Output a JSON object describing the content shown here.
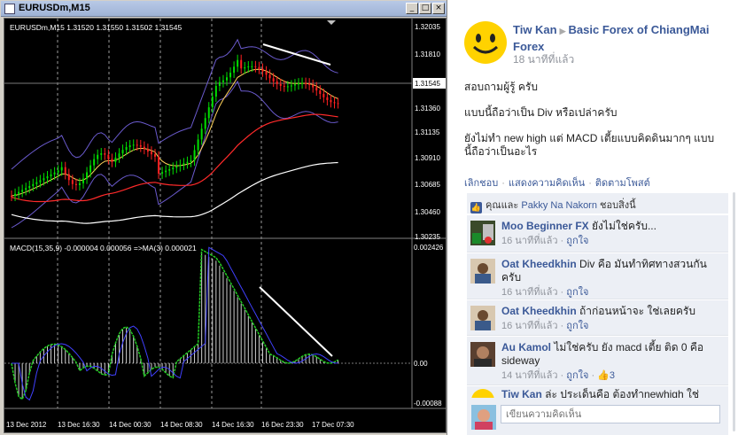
{
  "mt4": {
    "window_title": "EURUSDm,M15",
    "win_buttons": [
      "_",
      "□",
      "×"
    ],
    "info_line": "EURUSDm,M15  1.31520 1.31550 1.31502 1.31545",
    "price_ticks": [
      "1.32035",
      "1.31810",
      "1.31360",
      "1.31135",
      "1.30910",
      "1.30685",
      "1.30460",
      "1.30235"
    ],
    "current_price": "1.31545",
    "macd_label": "MACD(15,35,9) -0.000004 0.000056  =>MA(3) 0.000021",
    "macd_ticks": [
      "0.002426",
      "0.00",
      "-0.00088"
    ],
    "time_ticks": [
      "13 Dec 2012",
      "13 Dec 16:30",
      "14 Dec 00:30",
      "14 Dec 08:30",
      "14 Dec 16:30",
      "16 Dec 23:30",
      "17 Dec 07:30"
    ],
    "colors": {
      "bull": "#00e000",
      "bear": "#ff2020",
      "band": "#6a5acd",
      "ema_slow": "#ffffff",
      "ema_mid": "#ff2a2a",
      "ema_fast": "#ffd35a",
      "divergence_line": "#ffffff"
    }
  },
  "post": {
    "author": "Tiw Kan",
    "group": "Basic Forex of ChiangMai Forex",
    "time": "18 นาทีที่แล้ว",
    "lines": [
      "สอบถามผู้รู้ ครับ",
      "แบบนี้ถือว่าเป็น Div หรือเปล่าครับ",
      "ยังไม่ทำ new high แต่ MACD เตี้ยแบบคิดดินมากๆ แบบนี้ถือว่าเป็นอะไร"
    ],
    "actions": [
      "เลิกชอบ",
      "แสดงความคิดเห็น",
      "ติดตามโพสต์"
    ],
    "likes": {
      "prefix": "คุณและ",
      "name": "Pakky Na Nakorn",
      "suffix": "ชอบสิ่งนี้"
    }
  },
  "comments": [
    {
      "name": "Moo Beginner FX",
      "text": "ยังไม่ใช่ครับ...",
      "time": "16 นาทีที่แล้ว",
      "like": "ถูกใจ",
      "count": ""
    },
    {
      "name": "Oat Kheedkhin",
      "text": "Div คือ มันทำทิศทางสวนกันครับ",
      "time": "16 นาทีที่แล้ว",
      "like": "ถูกใจ",
      "count": ""
    },
    {
      "name": "Oat Kheedkhin",
      "text": "ถ้าก่อนหน้าจะ ใช่เลยครับ",
      "time": "16 นาทีที่แล้ว",
      "like": "ถูกใจ",
      "count": ""
    },
    {
      "name": "Au Kamol",
      "text": "ไม่ใช่ครับ ยัง macd เตี้ย ติด 0 คือ sideway",
      "time": "14 นาทีที่แล้ว",
      "like": "ถูกใจ",
      "count": "3"
    },
    {
      "name": "Tiw Kan",
      "text": "ล่ะ ประเด็นคือ ต้องทำnewhigh ใช่",
      "time": "",
      "like": "",
      "count": ""
    }
  ],
  "composer": {
    "placeholder": "เขียนความคิดเห็น"
  }
}
